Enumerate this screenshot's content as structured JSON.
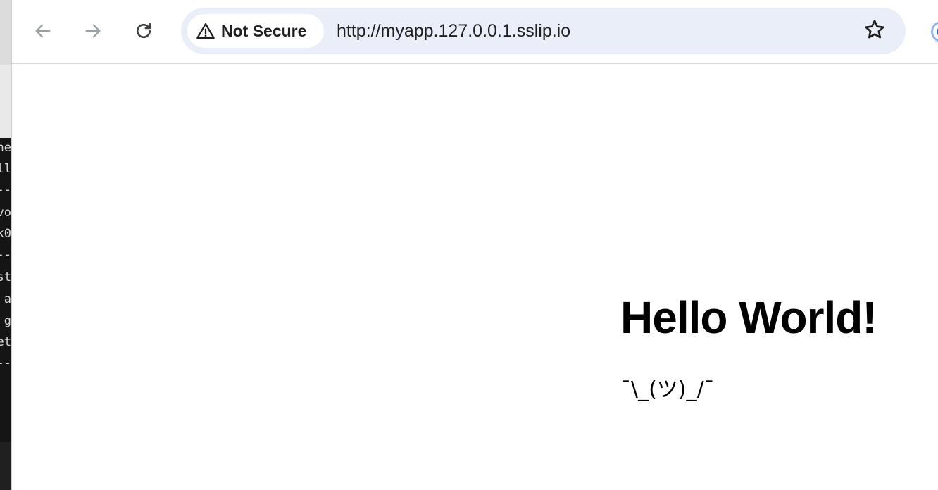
{
  "terminal": {
    "lines": [
      "ne",
      "ll",
      "--",
      "vo",
      "k0",
      "--",
      "st",
      " a",
      "g",
      "et",
      "--"
    ]
  },
  "browser": {
    "toolbar": {
      "back_icon": "arrow-left-icon",
      "forward_icon": "arrow-right-icon",
      "reload_icon": "reload-icon",
      "security_icon": "warning-triangle-icon",
      "security_label": "Not Secure",
      "url": "http://myapp.127.0.0.1.sslip.io",
      "bookmark_icon": "star-icon"
    }
  },
  "page": {
    "heading": "Hello World!",
    "shrug": "¯\\_(ツ)_/¯"
  },
  "colors": {
    "omnibox_background": "#e9eef8",
    "text": "#1f1f1f",
    "terminal_background": "#151515"
  }
}
